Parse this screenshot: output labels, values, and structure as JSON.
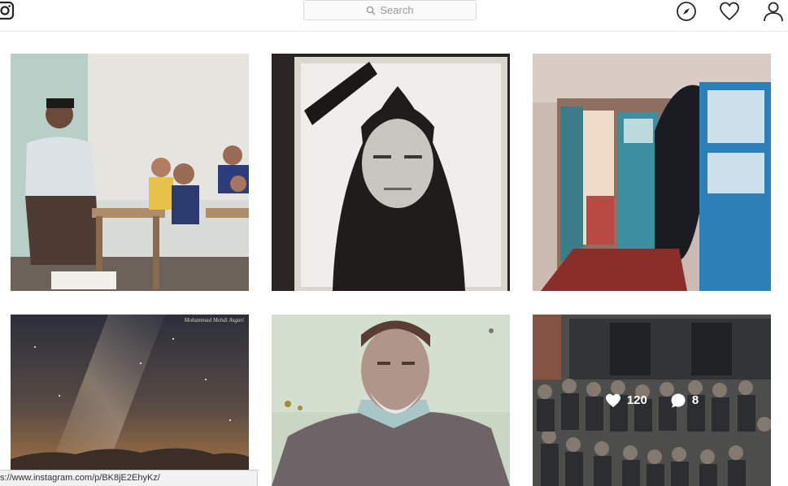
{
  "header": {
    "search_placeholder": "Search",
    "icons": [
      "instagram-logo-icon",
      "search-icon",
      "compass-icon",
      "heart-icon",
      "user-icon"
    ]
  },
  "posts": [
    {
      "row": 1,
      "col": 1,
      "alt": "classroom photo",
      "hovered": false
    },
    {
      "row": 1,
      "col": 2,
      "alt": "framed portrait of woman",
      "hovered": false
    },
    {
      "row": 1,
      "col": 3,
      "alt": "house doorway",
      "hovered": false
    },
    {
      "row": 2,
      "col": 1,
      "alt": "milky way night sky",
      "watermark": "Mohammad Mehdi Asgari",
      "hovered": false
    },
    {
      "row": 2,
      "col": 2,
      "alt": "portrait of old man",
      "hovered": false
    },
    {
      "row": 2,
      "col": 3,
      "alt": "class group photo",
      "hovered": true,
      "likes": "120",
      "comments": "8"
    }
  ],
  "hover_stats": {
    "likes": "120",
    "comments": "8"
  },
  "status_bar": {
    "url": "s://www.instagram.com/p/BK8jE2EhyKz/"
  },
  "colors": {
    "border": "#dbdbdb",
    "background": "#ffffff",
    "overlay": "rgba(0,0,0,0.28)"
  }
}
